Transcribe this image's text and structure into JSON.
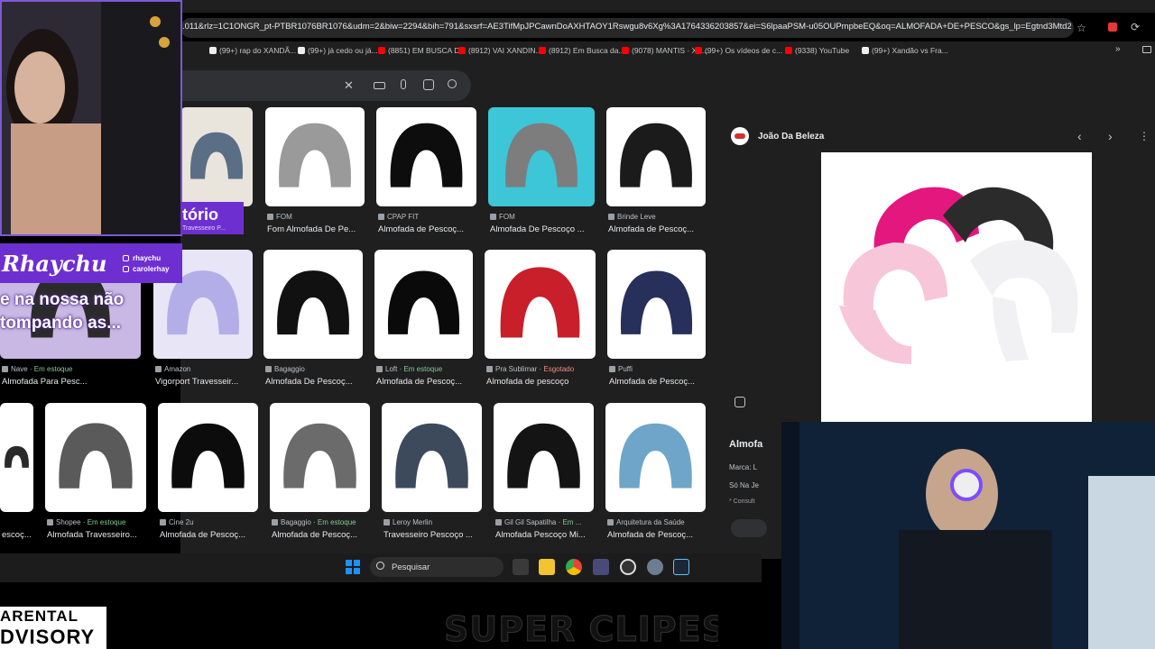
{
  "browser": {
    "url": ".011&rlz=1C1ONGR_pt-PTBR1076BR1076&udm=2&biw=2294&bih=791&sxsrf=AE3TifMpJPCawnDoAXHTAOY1Rswgu8v6Xg%3A1764336203857&ei=S6lpaaPSM-u05OUPmpbeEQ&oq=ALMOFADA+DE+PESCO&gs_lp=Egtnd3Mtd2l...",
    "bookmarks": [
      {
        "label": "(99+) rap do XANDÃ...",
        "color": "#eeeeee"
      },
      {
        "label": "(99+) já cedo ou já...",
        "color": "#eeeeee"
      },
      {
        "label": "(8851) EM BUSCA D...",
        "color": "#ff0000"
      },
      {
        "label": "(8912) VAI XANDIN...",
        "color": "#ff0000"
      },
      {
        "label": "(8912) Em Busca da...",
        "color": "#ff0000"
      },
      {
        "label": "(9078) MANTIS · XA...",
        "color": "#ff0000"
      },
      {
        "label": "(99+) Os vídeos de c...",
        "color": "#ff0000"
      },
      {
        "label": "(9338) YouTube",
        "color": "#ff0000"
      },
      {
        "label": "(99+) Xandão vs Fra...",
        "color": "#eeeeee"
      }
    ]
  },
  "results": [
    {
      "source": "",
      "title": "",
      "status": "",
      "status_type": "",
      "colors": [
        "#e9e4dc",
        "#5a6f86"
      ]
    },
    {
      "source": "FOM",
      "title": "Fom Almofada De Pe...",
      "status": "",
      "status_type": "",
      "colors": [
        "#ffffff",
        "#9a9a9a"
      ]
    },
    {
      "source": "CPAP FIT",
      "title": "Almofada de Pescoç...",
      "status": "",
      "status_type": "",
      "colors": [
        "#ffffff",
        "#0d0d0d"
      ]
    },
    {
      "source": "FOM",
      "title": "Almofada De Pescoço ...",
      "status": "",
      "status_type": "",
      "colors": [
        "#3cc6d8",
        "#7d7d7d"
      ]
    },
    {
      "source": "Brinde Leve",
      "title": "Almofada de Pescoç...",
      "status": "",
      "status_type": "",
      "colors": [
        "#ffffff",
        "#1b1b1b"
      ]
    },
    {
      "source": "Nave",
      "title": "Almofada Para Pesc...",
      "status": "Em estoque",
      "status_type": "st",
      "colors": [
        "#c9b8e4",
        "#2b2b2b"
      ]
    },
    {
      "source": "Amazon",
      "title": "Vigorport Travesseir...",
      "status": "",
      "status_type": "",
      "colors": [
        "#e8e6f6",
        "#b4aee8"
      ]
    },
    {
      "source": "Bagaggio",
      "title": "Almofada De Pescoç...",
      "status": "",
      "status_type": "",
      "colors": [
        "#ffffff",
        "#111111"
      ]
    },
    {
      "source": "Loft",
      "title": "Almofada de Pescoç...",
      "status": "Em estoque",
      "status_type": "st",
      "colors": [
        "#ffffff",
        "#0a0a0a"
      ]
    },
    {
      "source": "Pra Sublimar",
      "title": "Almofada de pescoço",
      "status": "Esgotado",
      "status_type": "so",
      "colors": [
        "#ffffff",
        "#c81f2a"
      ]
    },
    {
      "source": "Puffi",
      "title": "Almofada de Pescoç...",
      "status": "",
      "status_type": "",
      "colors": [
        "#ffffff",
        "#26305a"
      ]
    },
    {
      "source": "",
      "title": "escoç...",
      "status": "",
      "status_type": "",
      "colors": [
        "#ffffff",
        "#2a2a2a"
      ]
    },
    {
      "source": "Shopee",
      "title": "Almofada Travesseiro...",
      "status": "Em estoque",
      "status_type": "st",
      "colors": [
        "#ffffff",
        "#5a5a5a"
      ]
    },
    {
      "source": "Cine 2u",
      "title": "Almofada de Pescoç...",
      "status": "",
      "status_type": "",
      "colors": [
        "#ffffff",
        "#0c0c0c"
      ]
    },
    {
      "source": "Bagaggio",
      "title": "Almofada de Pescoç...",
      "status": "Em estoque",
      "status_type": "st",
      "colors": [
        "#ffffff",
        "#6b6b6b"
      ]
    },
    {
      "source": "Leroy Merlin",
      "title": "Travesseiro Pescoço ...",
      "status": "",
      "status_type": "",
      "colors": [
        "#ffffff",
        "#3d4a5c"
      ]
    },
    {
      "source": "Gil Gil Sapatilha",
      "title": "Almofada Pescoço Mi...",
      "status": "Em ...",
      "status_type": "st",
      "colors": [
        "#ffffff",
        "#141414"
      ]
    },
    {
      "source": "Arquitetura da Saúde",
      "title": "Almofada de Pescoç...",
      "status": "",
      "status_type": "",
      "colors": [
        "#ffffff",
        "#6fa5c8"
      ]
    }
  ],
  "panel": {
    "site_name": "João Da Beleza",
    "title": "Almofa",
    "brand": "Marca: L",
    "store": "Só Na Je",
    "consult": "* Consult"
  },
  "taskbar": {
    "search_label": "Pesquisar"
  },
  "overlays": {
    "streamer_name": "Rhaychu",
    "handle_1": "rhaychu",
    "handle_2": "carolerhay",
    "promo_text": "tório",
    "promo_sub": "Travesseiro P...",
    "caption_line_1": "e na nossa não",
    "caption_line_2": "tompando as...",
    "advisory_line_1": "ARENTAL",
    "advisory_line_2": "DVISORY",
    "brand_text": "SUPER CLIPES"
  }
}
